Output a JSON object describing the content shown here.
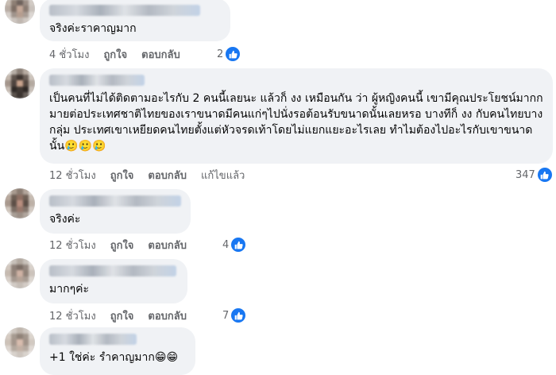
{
  "comments": [
    {
      "text": "จริงค่ะราคาญมาก",
      "time": "4 ชั่วโมง",
      "like": "ถูกใจ",
      "reply": "ตอบกลับ",
      "reactions": "2"
    },
    {
      "text": "เป็นคนที่ไม่ได้ติดตามอะไรกับ 2 คนนี้เลยนะ แล้วก็ งง เหมือนกัน ว่า ผู้หญิงคนนี้ เขามีคุณประโยชน์มากกมายต่อประเทศชาติไทยของเราขนาดมีคนแก่ๆไปนั่งรอต้อนรับขนาดนั้นเลยหรอ บางทีก็ งง กับคนไทยบางกลุ่ม ประเทศเขาเหยียดคนไทยตั้งแต่หัวจรดเท้าโดยไม่แยกแยะอะไรเลย ทำไมต้องไปอะไรกับเขาขนาดนั้น",
      "emoji": "🥲🥲🥲",
      "time": "12 ชั่วโมง",
      "like": "ถูกใจ",
      "reply": "ตอบกลับ",
      "edited": "แก้ไขแล้ว",
      "reactions": "347"
    },
    {
      "text": "จริงค่ะ",
      "time": "12 ชั่วโมง",
      "like": "ถูกใจ",
      "reply": "ตอบกลับ",
      "reactions": "4"
    },
    {
      "text": "มากๆค่ะ",
      "time": "12 ชั่วโมง",
      "like": "ถูกใจ",
      "reply": "ตอบกลับ",
      "reactions": "7"
    },
    {
      "text": "+1 ใช่ค่ะ รำคาญมาก",
      "emoji": "😁😁"
    }
  ],
  "colors": {
    "bubble": "#f0f2f5",
    "like_blue": "#1877f2",
    "meta_gray": "#65676b"
  },
  "icons": {
    "like": "thumbs-up-icon"
  }
}
